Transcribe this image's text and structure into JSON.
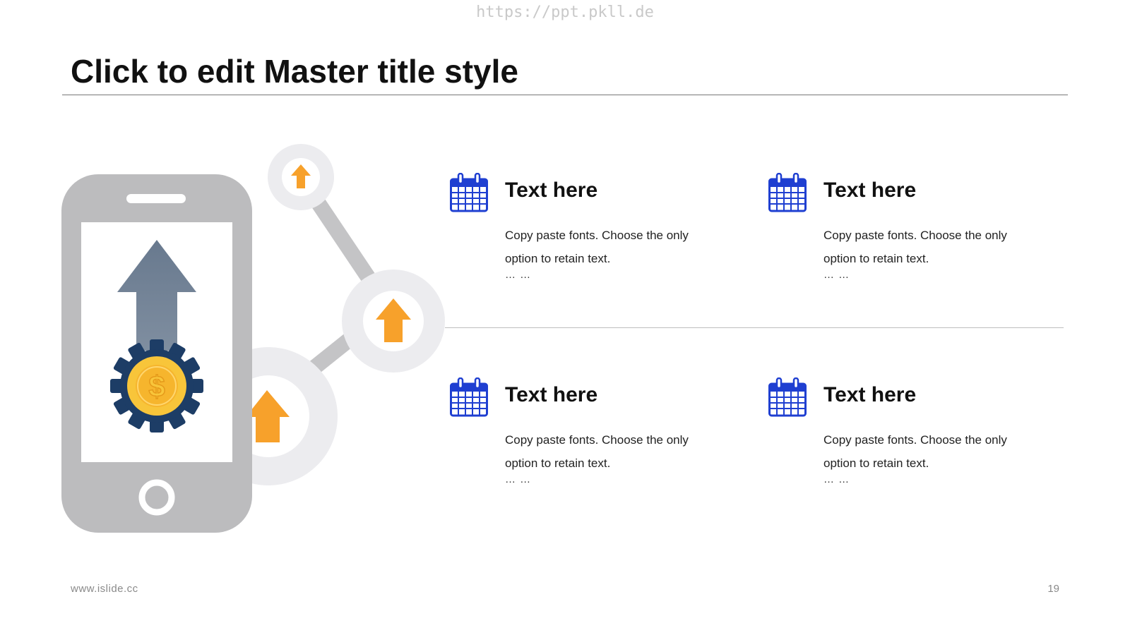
{
  "watermark": "https://ppt.pkll.de",
  "slide": {
    "title": "Click to edit Master title style",
    "page_number": "19"
  },
  "footer": {
    "website": "www.islide.cc"
  },
  "items": [
    {
      "heading": "Text here",
      "body": "Copy paste fonts. Choose the only option to retain text.",
      "ellipsis": "…  …",
      "icon": "calendar-icon"
    },
    {
      "heading": "Text here",
      "body": "Copy paste fonts. Choose the only option to retain text.",
      "ellipsis": "…  …",
      "icon": "calendar-icon"
    },
    {
      "heading": "Text here",
      "body": "Copy paste fonts. Choose the only option to retain text.",
      "ellipsis": "…  …",
      "icon": "calendar-icon"
    },
    {
      "heading": "Text here",
      "body": "Copy paste fonts. Choose the only option to retain text.",
      "ellipsis": "…  …",
      "icon": "calendar-icon"
    }
  ],
  "illustration": {
    "icons": [
      "smartphone-icon",
      "up-arrow-icon",
      "gear-dollar-icon",
      "node-arrow-icon"
    ],
    "currency_symbol": "$"
  },
  "colors": {
    "accent_blue": "#1f3fd1",
    "arrow_orange": "#f7a12b",
    "phone_gray": "#bcbcbe",
    "gear_navy": "#1d3d66",
    "coin_yellow": "#f8c53a"
  }
}
